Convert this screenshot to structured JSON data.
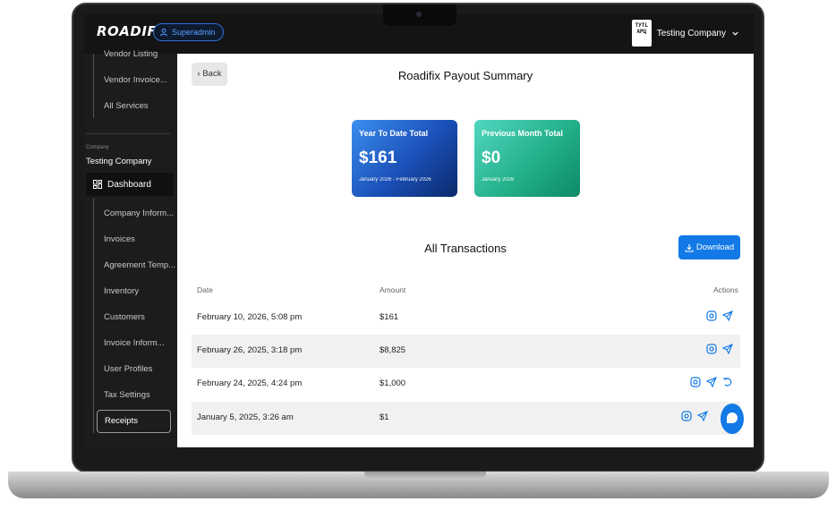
{
  "app": {
    "logo_text": "ROADIFIX",
    "role_badge": "Superadmin"
  },
  "company_menu": {
    "name": "Testing Company",
    "logo_text": "ТУТL\nАРЦ"
  },
  "sidebar": {
    "top_items": [
      {
        "label": "Vendor Listing"
      },
      {
        "label": "Vendor Invoice..."
      },
      {
        "label": "All Services"
      }
    ],
    "company_caption": "Company",
    "company_name": "Testing Company",
    "dashboard_label": "Dashboard",
    "items": [
      {
        "label": "Company Inform..."
      },
      {
        "label": "Invoices"
      },
      {
        "label": "Agreement Temp..."
      },
      {
        "label": "Inventory"
      },
      {
        "label": "Customers"
      },
      {
        "label": "Invoice Inform..."
      },
      {
        "label": "User Profiles"
      },
      {
        "label": "Tax Settings"
      }
    ],
    "active_item": "Receipts"
  },
  "main": {
    "back_label": "Back",
    "title": "Roadifix Payout Summary",
    "cards": {
      "ytd": {
        "title": "Year To Date Total",
        "amount": "$161",
        "range": "January 2026 - February 2026"
      },
      "prev": {
        "title": "Previous Month Total",
        "amount": "$0",
        "range": "January 2026"
      }
    },
    "section_title": "All Transactions",
    "download_label": "Download",
    "columns": {
      "date": "Date",
      "amount": "Amount",
      "actions": "Actions"
    },
    "rows": [
      {
        "date": "February 10, 2026, 5:08 pm",
        "amount": "$161"
      },
      {
        "date": "February 26, 2025, 3:18 pm",
        "amount": "$8,825"
      },
      {
        "date": "February 24, 2025, 4:24 pm",
        "amount": "$1,000"
      },
      {
        "date": "January 5, 2025, 3:26 am",
        "amount": "$1"
      }
    ]
  },
  "colors": {
    "accent": "#1279e6",
    "ytd_card": "#1a4fb6",
    "prev_card": "#23b08a"
  }
}
